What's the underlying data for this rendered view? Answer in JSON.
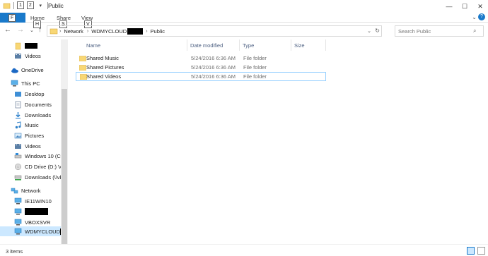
{
  "titlebar": {
    "title": "Public",
    "keytips": [
      "1",
      "2"
    ],
    "controls": [
      "minimize-icon",
      "maximize-icon",
      "close-icon"
    ]
  },
  "ribbon": {
    "file": {
      "label": "F"
    },
    "tabs": [
      {
        "label": "Home",
        "keytip": "H"
      },
      {
        "label": "Share",
        "keytip": "S"
      },
      {
        "label": "View",
        "keytip": "V"
      }
    ],
    "accent": "#1979ca"
  },
  "address": {
    "crumbs": [
      "Network",
      "WDMYCLOUD",
      "Public"
    ],
    "search_placeholder": "Search Public"
  },
  "nav": {
    "items": [
      {
        "label": "",
        "icon": "folder-icon",
        "redacted": true
      },
      {
        "label": "Videos",
        "icon": "videos-icon"
      },
      {
        "label": "OneDrive",
        "icon": "onedrive-icon"
      },
      {
        "label": "This PC",
        "icon": "pc-icon"
      },
      {
        "label": "Desktop",
        "icon": "desktop-icon"
      },
      {
        "label": "Documents",
        "icon": "documents-icon"
      },
      {
        "label": "Downloads",
        "icon": "downloads-icon"
      },
      {
        "label": "Music",
        "icon": "music-icon"
      },
      {
        "label": "Pictures",
        "icon": "pictures-icon"
      },
      {
        "label": "Videos",
        "icon": "videos-icon"
      },
      {
        "label": "Windows 10 (C:)",
        "icon": "drive-icon"
      },
      {
        "label": "CD Drive (D:) Vir",
        "icon": "cd-drive-icon"
      },
      {
        "label": "Downloads (\\\\vb",
        "icon": "network-drive-icon"
      },
      {
        "label": "Network",
        "icon": "network-icon"
      },
      {
        "label": "IE11WIN10",
        "icon": "computer-icon"
      },
      {
        "label": "",
        "icon": "computer-icon",
        "redacted": true
      },
      {
        "label": "VBOXSVR",
        "icon": "computer-icon"
      },
      {
        "label": "WDMYCLOUD",
        "icon": "computer-icon",
        "selected": true
      }
    ]
  },
  "columns": [
    "Name",
    "Date modified",
    "Type",
    "Size"
  ],
  "files": [
    {
      "name": "Shared Music",
      "date": "5/24/2016 6:36 AM",
      "type": "File folder",
      "size": ""
    },
    {
      "name": "Shared Pictures",
      "date": "5/24/2016 6:36 AM",
      "type": "File folder",
      "size": ""
    },
    {
      "name": "Shared Videos",
      "date": "5/24/2016 6:36 AM",
      "type": "File folder",
      "size": ""
    }
  ],
  "status": {
    "count": "3 items"
  },
  "colors": {
    "folder": "#f8d775",
    "selection": "#cce8ff",
    "focus": "#99d1ff"
  }
}
